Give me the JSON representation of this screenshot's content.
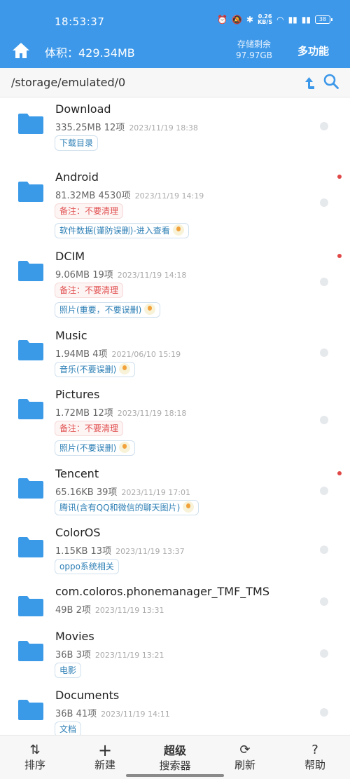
{
  "status": {
    "time": "18:53:37",
    "speed_top": "0.26",
    "speed_bottom": "KB/S",
    "battery": "38"
  },
  "header": {
    "volume_label": "体积：429.34MB",
    "storage_label": "存储剩余",
    "storage_value": "97.97GB",
    "more_label": "多功能"
  },
  "path": "/storage/emulated/0",
  "folders": [
    {
      "name": "Download",
      "size": "335.25MB",
      "count": "12项",
      "date": "2023/11/19 18:38",
      "tags": [
        {
          "text": "下载目录",
          "type": "blue",
          "bulb": false
        }
      ],
      "dot": false
    },
    {
      "name": "Android",
      "size": "81.32MB",
      "count": "4530项",
      "date": "2023/11/19 14:19",
      "tags": [
        {
          "text": "备注：不要清理",
          "type": "red",
          "bulb": false
        },
        {
          "text": "软件数据(谨防误删)-进入查看",
          "type": "blue",
          "bulb": true
        }
      ],
      "dot": true
    },
    {
      "name": "DCIM",
      "size": "9.06MB",
      "count": "19项",
      "date": "2023/11/19 14:18",
      "tags": [
        {
          "text": "备注：不要清理",
          "type": "red",
          "bulb": false
        },
        {
          "text": "照片(重要，不要误删)",
          "type": "blue",
          "bulb": true
        }
      ],
      "dot": true
    },
    {
      "name": "Music",
      "size": "1.94MB",
      "count": "4项",
      "date": "2021/06/10 15:19",
      "tags": [
        {
          "text": "音乐(不要误删)",
          "type": "blue",
          "bulb": true
        }
      ],
      "dot": false
    },
    {
      "name": "Pictures",
      "size": "1.72MB",
      "count": "12项",
      "date": "2023/11/19 18:18",
      "tags": [
        {
          "text": "备注：不要清理",
          "type": "red",
          "bulb": false
        },
        {
          "text": "照片(不要误删)",
          "type": "blue",
          "bulb": true
        }
      ],
      "dot": false
    },
    {
      "name": "Tencent",
      "size": "65.16KB",
      "count": "39项",
      "date": "2023/11/19 17:01",
      "tags": [
        {
          "text": "腾讯(含有QQ和微信的聊天图片)",
          "type": "blue",
          "bulb": true
        }
      ],
      "dot": true
    },
    {
      "name": "ColorOS",
      "size": "1.15KB",
      "count": "13项",
      "date": "2023/11/19 13:37",
      "tags": [
        {
          "text": "oppo系统相关",
          "type": "blue",
          "bulb": false
        }
      ],
      "dot": false
    },
    {
      "name": "com.coloros.phonemanager_TMF_TMS",
      "size": "49B",
      "count": "2项",
      "date": "2023/11/19 13:31",
      "tags": [],
      "dot": false
    },
    {
      "name": "Movies",
      "size": "36B",
      "count": "3项",
      "date": "2023/11/19 13:21",
      "tags": [
        {
          "text": "电影",
          "type": "blue",
          "bulb": false
        }
      ],
      "dot": false
    },
    {
      "name": "Documents",
      "size": "36B",
      "count": "41项",
      "date": "2023/11/19 14:11",
      "tags": [
        {
          "text": "文档",
          "type": "blue",
          "bulb": false
        }
      ],
      "dot": false
    }
  ],
  "bottom": {
    "sort": {
      "icon": "⇅",
      "label": "排序"
    },
    "new": {
      "icon": "+",
      "label": "新建"
    },
    "super": {
      "label1": "超级",
      "label2": "搜索器"
    },
    "refresh": {
      "icon": "⟳",
      "label": "刷新"
    },
    "help": {
      "icon": "?",
      "label": "帮助"
    }
  },
  "colors": {
    "accent": "#3d98e9",
    "folder": "#3a9ae8",
    "danger": "#e25252"
  },
  "icons": {
    "home": "home-icon",
    "up": "go-up-icon",
    "search": "search-icon",
    "folder": "folder-icon"
  }
}
